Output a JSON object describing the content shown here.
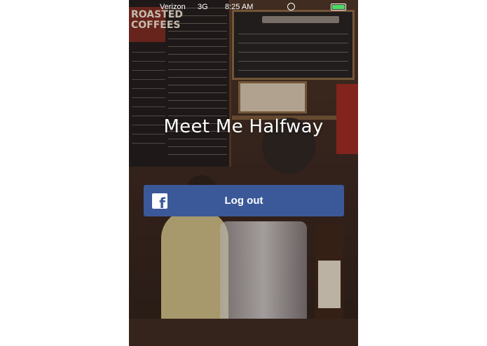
{
  "status_bar": {
    "carrier": "Verizon",
    "network": "3G",
    "time": "8:25 AM",
    "battery_color": "#4cd964"
  },
  "app": {
    "title": "Meet Me Halfway"
  },
  "logout_button": {
    "label": "Log out",
    "icon": "facebook-icon",
    "color": "#3b5998"
  }
}
